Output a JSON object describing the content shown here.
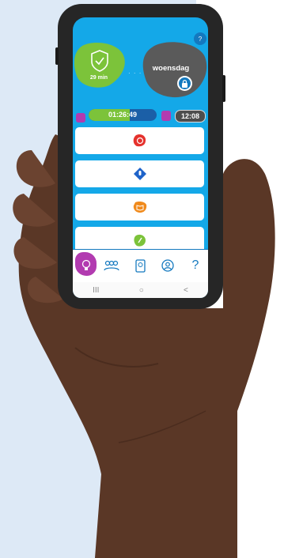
{
  "app": {
    "help_button": "?",
    "shield": {
      "time": "29 min"
    },
    "day": {
      "label": "woensdag"
    },
    "timer": {
      "value": "01:26:49",
      "progress": 0.6
    },
    "clock": {
      "time": "12:08"
    },
    "cards": [
      {
        "icon": "brain-icon",
        "color": "#e5322d"
      },
      {
        "icon": "microphone-icon",
        "color": "#1e63c9"
      },
      {
        "icon": "book-icon",
        "color": "#f08a1c"
      },
      {
        "icon": "writing-icon",
        "color": "#7cc33a"
      }
    ],
    "nav": {
      "items": [
        "lightbulb-icon",
        "group-icon",
        "tablet-icon",
        "profile-icon",
        "question-icon"
      ],
      "question_label": "?"
    },
    "system_bar": {
      "recents": "III",
      "home": "○",
      "back": "<"
    }
  },
  "colors": {
    "screen_bg": "#14a8e8",
    "accent_blue": "#1479bf",
    "purple": "#b23bb0",
    "green": "#7cc33a",
    "grey": "#5a5a5a"
  }
}
